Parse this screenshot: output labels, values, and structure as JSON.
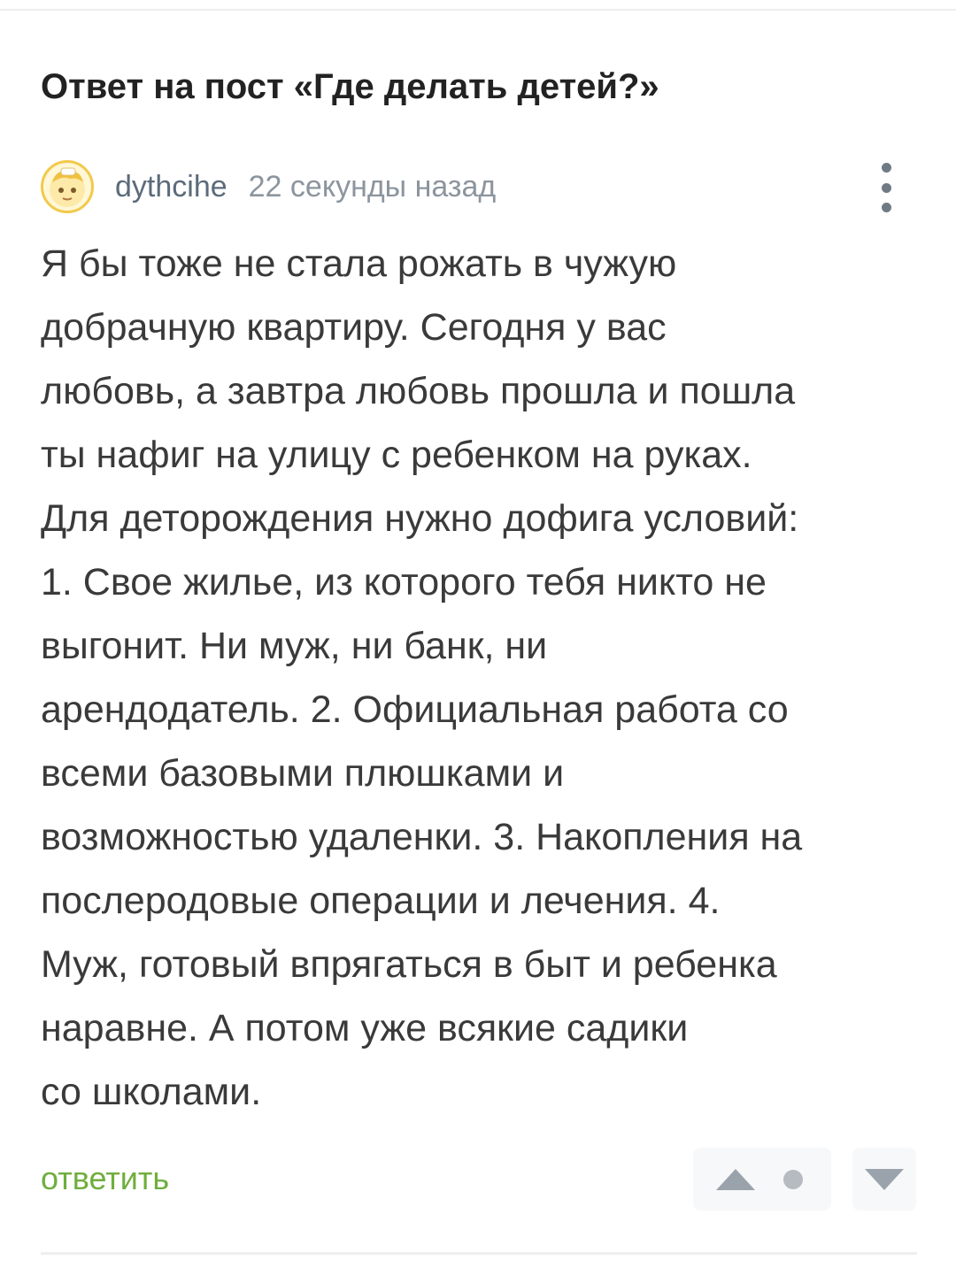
{
  "post": {
    "title": "Ответ на пост «Где делать детей?»"
  },
  "comment": {
    "author": "dythcihe",
    "timestamp": "22 секунды назад",
    "avatar_icon": "avatar-face-icon",
    "more_icon": "more-vertical-icon",
    "body_lines": [
      "Я бы тоже не стала рожать в чужую",
      "добрачную квартиру. Сегодня у вас",
      "любовь, а завтра любовь прошла и пошла",
      "ты нафиг на улицу с ребенком на руках.",
      "Для деторождения нужно дофига условий:",
      "1. Свое жилье, из которого тебя никто не",
      "выгонит. Ни муж, ни банк, ни",
      "арендодатель. 2. Официальная работа со",
      "всеми базовыми плюшками и",
      "возможностью удаленки. 3. Накопления на",
      "послеродовые операции и лечения. 4.",
      "Муж, готовый впрягаться в быт и ребенка",
      "наравне. А потом уже всякие садики",
      "со школами."
    ],
    "reply_label": "ответить",
    "vote_up_icon": "triangle-up-icon",
    "vote_down_icon": "triangle-down-icon",
    "rating_icon": "rating-dot-icon"
  },
  "colors": {
    "reply": "#6fae3d",
    "username": "#5c6b7a",
    "timestamp": "#8c959e",
    "avatar_border": "#f2c94c",
    "vote_bg": "#f7f8f9"
  }
}
